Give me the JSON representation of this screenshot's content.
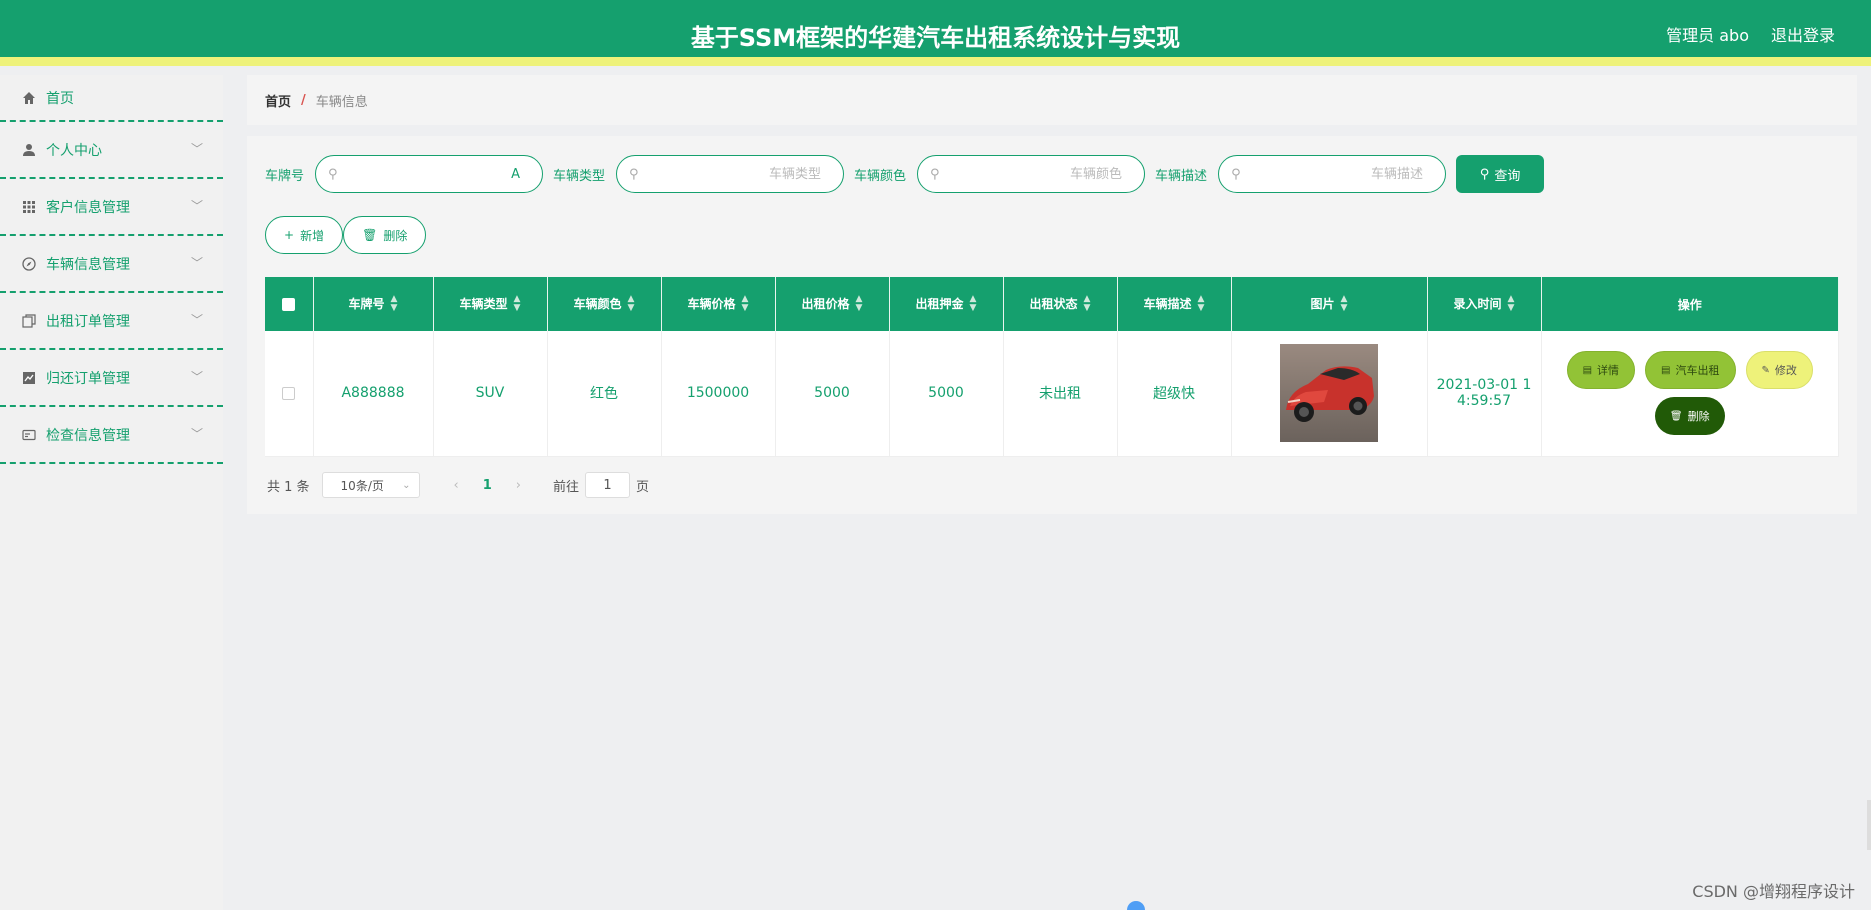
{
  "header": {
    "title": "基于SSM框架的华建汽车出租系统设计与实现",
    "user": "管理员 abo",
    "logout": "退出登录"
  },
  "sidebar": {
    "items": [
      {
        "label": "首页",
        "icon": "home-icon"
      },
      {
        "label": "个人中心",
        "icon": "user-icon"
      },
      {
        "label": "客户信息管理",
        "icon": "grid-icon"
      },
      {
        "label": "车辆信息管理",
        "icon": "compass-icon"
      },
      {
        "label": "出租订单管理",
        "icon": "copy-icon"
      },
      {
        "label": "归还订单管理",
        "icon": "chart-icon"
      },
      {
        "label": "检查信息管理",
        "icon": "card-icon"
      }
    ]
  },
  "breadcrumb": {
    "home": "首页",
    "separator": "/",
    "current": "车辆信息"
  },
  "search": {
    "fields": [
      {
        "label": "车牌号",
        "value": "A",
        "placeholder": ""
      },
      {
        "label": "车辆类型",
        "value": "",
        "placeholder": "车辆类型"
      },
      {
        "label": "车辆颜色",
        "value": "",
        "placeholder": "车辆颜色"
      },
      {
        "label": "车辆描述",
        "value": "",
        "placeholder": "车辆描述"
      }
    ],
    "query_label": "查询"
  },
  "actions": {
    "add_label": "新增",
    "delete_label": "删除"
  },
  "table": {
    "headers": [
      "车牌号",
      "车辆类型",
      "车辆颜色",
      "车辆价格",
      "出租价格",
      "出租押金",
      "出租状态",
      "车辆描述",
      "图片",
      "录入时间",
      "操作"
    ],
    "rows": [
      {
        "plate": "A888888",
        "type": "SUV",
        "color": "红色",
        "price": "1500000",
        "rent_price": "5000",
        "deposit": "5000",
        "status": "未出租",
        "desc": "超级快",
        "time_line1": "2021-03-01 1",
        "time_line2": "4:59:57",
        "ops": {
          "detail": "详情",
          "rent": "汽车出租",
          "edit": "修改",
          "delete": "删除"
        }
      }
    ]
  },
  "pager": {
    "total": "共 1 条",
    "page_size": "10条/页",
    "current_page": "1",
    "goto_prefix": "前往",
    "goto_value": "1",
    "goto_suffix": "页"
  },
  "watermark": "CSDN @增翔程序设计",
  "colors": {
    "primary": "#15a06e",
    "accent_yellow": "#eef27a",
    "op_green": "#92c336",
    "op_dark": "#215a07"
  }
}
